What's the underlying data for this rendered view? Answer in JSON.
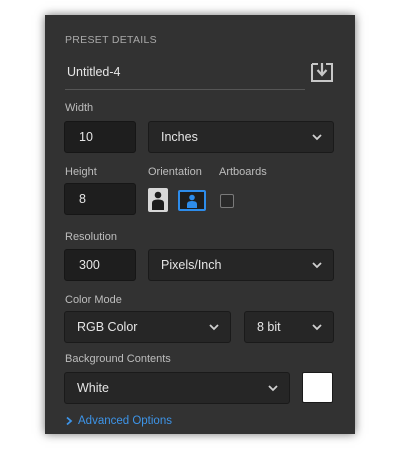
{
  "preset": {
    "section_title": "PRESET DETAILS",
    "name": "Untitled-4",
    "save_icon": "save-preset-icon"
  },
  "width": {
    "label": "Width",
    "value": "10",
    "unit": "Inches"
  },
  "height": {
    "label": "Height",
    "value": "8"
  },
  "orientation": {
    "label": "Orientation",
    "selected": "landscape",
    "accent_color": "#2d8ceb"
  },
  "artboards": {
    "label": "Artboards",
    "checked": false
  },
  "resolution": {
    "label": "Resolution",
    "value": "300",
    "unit": "Pixels/Inch"
  },
  "color_mode": {
    "label": "Color Mode",
    "mode": "RGB Color",
    "depth": "8 bit"
  },
  "background": {
    "label": "Background Contents",
    "value": "White",
    "swatch_color": "#ffffff"
  },
  "advanced": {
    "label": "Advanced Options"
  }
}
